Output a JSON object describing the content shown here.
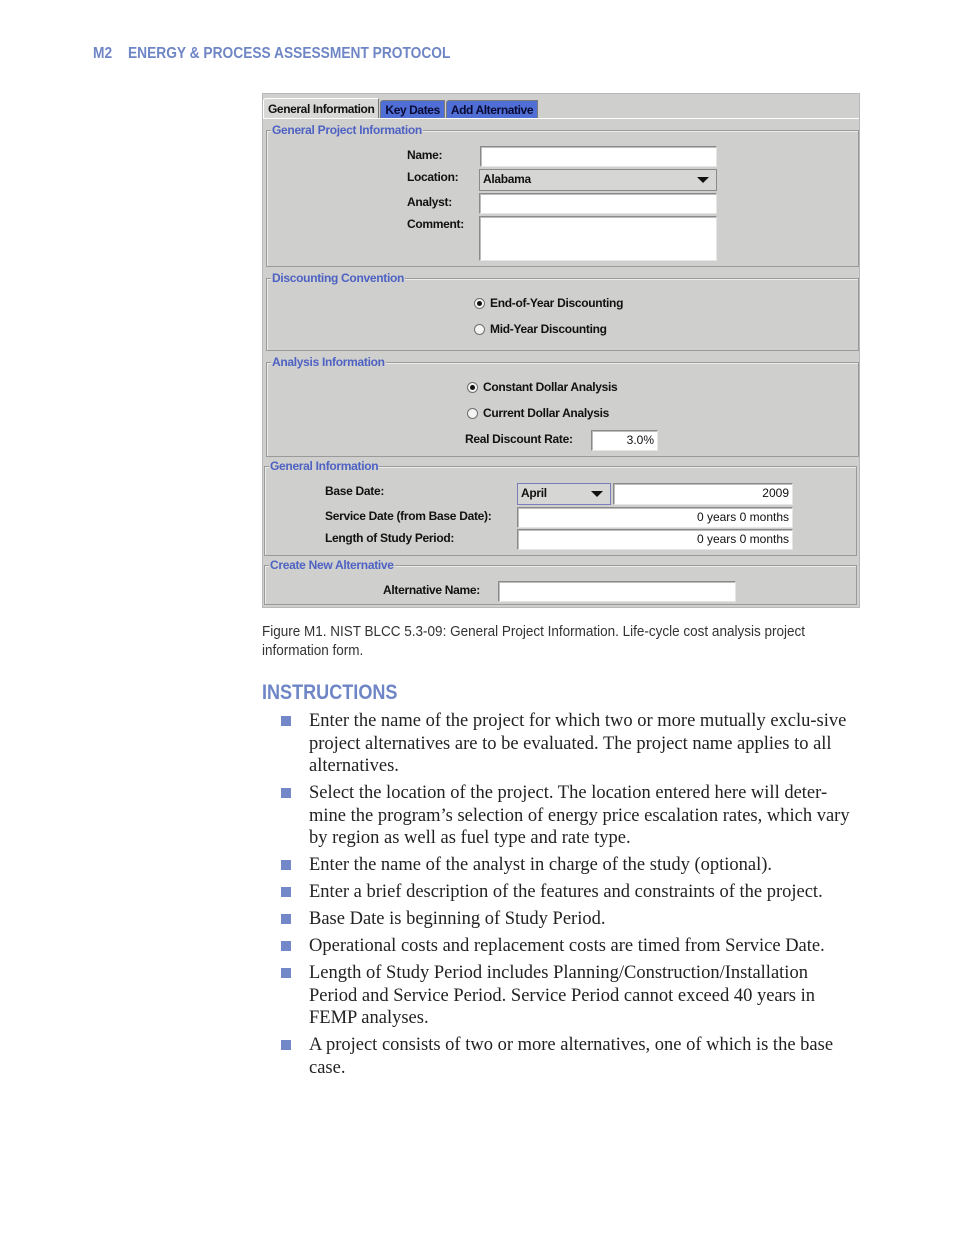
{
  "running_head": {
    "page": "M2",
    "title": "ENERGY & PROCESS ASSESSMENT PROTOCOL"
  },
  "app": {
    "tabs": [
      {
        "label": "General Information",
        "active": true
      },
      {
        "label": "Key Dates",
        "active": false
      },
      {
        "label": "Add Alternative",
        "active": false
      }
    ],
    "general_project": {
      "title": "General Project Information",
      "name_label": "Name:",
      "name_value": "",
      "location_label": "Location:",
      "location_value": "Alabama",
      "analyst_label": "Analyst:",
      "analyst_value": "",
      "comment_label": "Comment:",
      "comment_value": ""
    },
    "discounting": {
      "title": "Discounting Convention",
      "options": [
        {
          "label": "End-of-Year Discounting",
          "selected": true
        },
        {
          "label": "Mid-Year Discounting",
          "selected": false
        }
      ]
    },
    "analysis": {
      "title": "Analysis Information",
      "options": [
        {
          "label": "Constant Dollar Analysis",
          "selected": true
        },
        {
          "label": "Current Dollar Analysis",
          "selected": false
        }
      ],
      "rate_label": "Real Discount Rate:",
      "rate_value": "3.0%"
    },
    "general_info": {
      "title": "General Information",
      "base_date_label": "Base Date:",
      "base_month": "April",
      "base_year": "2009",
      "service_label": "Service Date (from Base Date):",
      "service_value": "0 years 0 months",
      "study_label": "Length of Study Period:",
      "study_value": "0 years 0 months"
    },
    "create_alt": {
      "title": "Create New Alternative",
      "name_label": "Alternative Name:",
      "name_value": ""
    }
  },
  "caption": "Figure M1. NIST BLCC 5.3-09: General Project Information. Life-cycle cost analysis project information form.",
  "instructions": {
    "heading": "INSTRUCTIONS",
    "items": [
      "Enter the name of the project for which two or more mutually exclu-sive project alternatives are to be evaluated. The project name applies to all alternatives.",
      "Select the location of the project. The location entered here will deter-mine the program’s selection of energy price escalation rates, which vary by region as well as fuel type and rate type.",
      "Enter the name of the analyst in charge of the study (optional).",
      "Enter a brief description of the features and constraints of the project.",
      "Base Date is beginning of Study Period.",
      "Operational costs and replacement costs are timed from Service Date.",
      "Length of Study Period includes Planning/Construction/Installation Period and Service Period. Service Period cannot exceed 40 years in FEMP analyses.",
      "A project consists of two or more alternatives, one of which is the base case."
    ]
  },
  "colors": {
    "accent": "#6f86c6",
    "group_title": "#4e62c4",
    "tab_inactive": "#4f6fd6",
    "panel": "#cfcfcd"
  }
}
